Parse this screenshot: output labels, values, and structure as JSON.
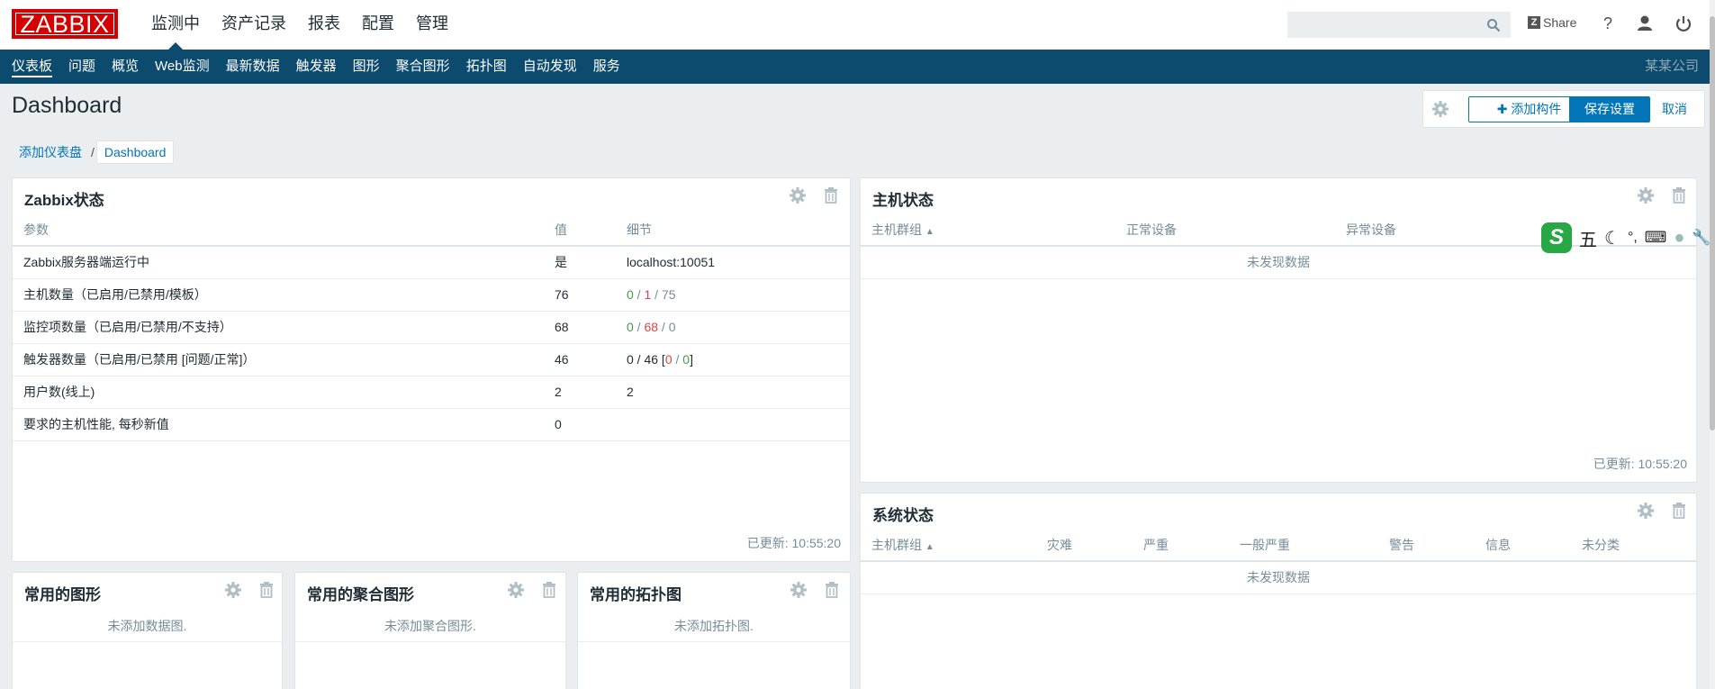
{
  "logo": "ZABBIX",
  "top_menu": [
    "监测中",
    "资产记录",
    "报表",
    "配置",
    "管理"
  ],
  "search": {
    "placeholder": ""
  },
  "share_label": "Share",
  "help_label": "?",
  "sub_nav": [
    "仪表板",
    "问题",
    "概览",
    "Web监测",
    "最新数据",
    "触发器",
    "图形",
    "聚合图形",
    "拓扑图",
    "自动发现",
    "服务"
  ],
  "company": "某某公司",
  "page": {
    "title": "Dashboard",
    "add_widget": "添加构件",
    "save": "保存设置",
    "cancel": "取消"
  },
  "breadcrumb": {
    "parent": "添加仪表盘",
    "separator": "/",
    "current": "Dashboard"
  },
  "zabbix_status": {
    "title": "Zabbix状态",
    "headers": [
      "参数",
      "值",
      "细节"
    ],
    "rows": [
      {
        "param": "Zabbix服务器端运行中",
        "value": "是",
        "details": [
          "localhost:10051"
        ]
      },
      {
        "param": "主机数量（已启用/已禁用/模板）",
        "value": "76",
        "details": [
          "0",
          " / ",
          "1",
          " / ",
          "75"
        ]
      },
      {
        "param": "监控项数量（已启用/已禁用/不支持）",
        "value": "68",
        "details": [
          "0",
          " / ",
          "68",
          " / ",
          "0"
        ]
      },
      {
        "param": "触发器数量（已启用/已禁用 [问题/正常]）",
        "value": "46",
        "details": [
          "0 / 46 [",
          "0",
          " / ",
          "0",
          "]"
        ]
      },
      {
        "param": "用户数(线上)",
        "value": "2",
        "details": [
          "2"
        ]
      },
      {
        "param": "要求的主机性能, 每秒新值",
        "value": "0",
        "details": [
          ""
        ]
      }
    ],
    "updated": "已更新: 10:55:20"
  },
  "host_status": {
    "title": "主机状态",
    "headers": [
      "主机群组",
      "正常设备",
      "异常设备"
    ],
    "sort_arrow": "▲",
    "no_data": "未发现数据",
    "updated": "已更新: 10:55:20"
  },
  "system_status": {
    "title": "系统状态",
    "headers": [
      "主机群组",
      "灾难",
      "严重",
      "一般严重",
      "警告",
      "信息",
      "未分类"
    ],
    "sort_arrow": "▲",
    "no_data": "未发现数据"
  },
  "fav_graphs": {
    "title": "常用的图形",
    "empty": "未添加数据图."
  },
  "fav_screens": {
    "title": "常用的聚合图形",
    "empty": "未添加聚合图形."
  },
  "fav_maps": {
    "title": "常用的拓扑图",
    "empty": "未添加拓扑图."
  },
  "ime": {
    "logo": "S",
    "mode": "五"
  }
}
